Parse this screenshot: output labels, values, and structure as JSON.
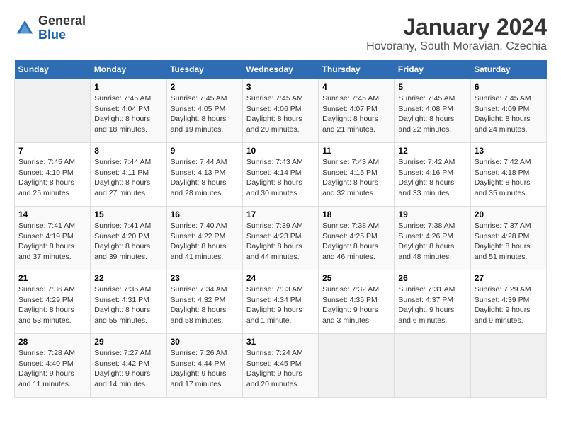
{
  "header": {
    "logo_line1": "General",
    "logo_line2": "Blue",
    "title": "January 2024",
    "subtitle": "Hovorany, South Moravian, Czechia"
  },
  "days_of_week": [
    "Sunday",
    "Monday",
    "Tuesday",
    "Wednesday",
    "Thursday",
    "Friday",
    "Saturday"
  ],
  "weeks": [
    [
      {
        "day": "",
        "empty": true
      },
      {
        "day": "1",
        "sunrise": "7:45 AM",
        "sunset": "4:04 PM",
        "daylight": "8 hours and 18 minutes."
      },
      {
        "day": "2",
        "sunrise": "7:45 AM",
        "sunset": "4:05 PM",
        "daylight": "8 hours and 19 minutes."
      },
      {
        "day": "3",
        "sunrise": "7:45 AM",
        "sunset": "4:06 PM",
        "daylight": "8 hours and 20 minutes."
      },
      {
        "day": "4",
        "sunrise": "7:45 AM",
        "sunset": "4:07 PM",
        "daylight": "8 hours and 21 minutes."
      },
      {
        "day": "5",
        "sunrise": "7:45 AM",
        "sunset": "4:08 PM",
        "daylight": "8 hours and 22 minutes."
      },
      {
        "day": "6",
        "sunrise": "7:45 AM",
        "sunset": "4:09 PM",
        "daylight": "8 hours and 24 minutes."
      }
    ],
    [
      {
        "day": "7",
        "sunrise": "7:45 AM",
        "sunset": "4:10 PM",
        "daylight": "8 hours and 25 minutes."
      },
      {
        "day": "8",
        "sunrise": "7:44 AM",
        "sunset": "4:11 PM",
        "daylight": "8 hours and 27 minutes."
      },
      {
        "day": "9",
        "sunrise": "7:44 AM",
        "sunset": "4:13 PM",
        "daylight": "8 hours and 28 minutes."
      },
      {
        "day": "10",
        "sunrise": "7:43 AM",
        "sunset": "4:14 PM",
        "daylight": "8 hours and 30 minutes."
      },
      {
        "day": "11",
        "sunrise": "7:43 AM",
        "sunset": "4:15 PM",
        "daylight": "8 hours and 32 minutes."
      },
      {
        "day": "12",
        "sunrise": "7:42 AM",
        "sunset": "4:16 PM",
        "daylight": "8 hours and 33 minutes."
      },
      {
        "day": "13",
        "sunrise": "7:42 AM",
        "sunset": "4:18 PM",
        "daylight": "8 hours and 35 minutes."
      }
    ],
    [
      {
        "day": "14",
        "sunrise": "7:41 AM",
        "sunset": "4:19 PM",
        "daylight": "8 hours and 37 minutes."
      },
      {
        "day": "15",
        "sunrise": "7:41 AM",
        "sunset": "4:20 PM",
        "daylight": "8 hours and 39 minutes."
      },
      {
        "day": "16",
        "sunrise": "7:40 AM",
        "sunset": "4:22 PM",
        "daylight": "8 hours and 41 minutes."
      },
      {
        "day": "17",
        "sunrise": "7:39 AM",
        "sunset": "4:23 PM",
        "daylight": "8 hours and 44 minutes."
      },
      {
        "day": "18",
        "sunrise": "7:38 AM",
        "sunset": "4:25 PM",
        "daylight": "8 hours and 46 minutes."
      },
      {
        "day": "19",
        "sunrise": "7:38 AM",
        "sunset": "4:26 PM",
        "daylight": "8 hours and 48 minutes."
      },
      {
        "day": "20",
        "sunrise": "7:37 AM",
        "sunset": "4:28 PM",
        "daylight": "8 hours and 51 minutes."
      }
    ],
    [
      {
        "day": "21",
        "sunrise": "7:36 AM",
        "sunset": "4:29 PM",
        "daylight": "8 hours and 53 minutes."
      },
      {
        "day": "22",
        "sunrise": "7:35 AM",
        "sunset": "4:31 PM",
        "daylight": "8 hours and 55 minutes."
      },
      {
        "day": "23",
        "sunrise": "7:34 AM",
        "sunset": "4:32 PM",
        "daylight": "8 hours and 58 minutes."
      },
      {
        "day": "24",
        "sunrise": "7:33 AM",
        "sunset": "4:34 PM",
        "daylight": "9 hours and 1 minute."
      },
      {
        "day": "25",
        "sunrise": "7:32 AM",
        "sunset": "4:35 PM",
        "daylight": "9 hours and 3 minutes."
      },
      {
        "day": "26",
        "sunrise": "7:31 AM",
        "sunset": "4:37 PM",
        "daylight": "9 hours and 6 minutes."
      },
      {
        "day": "27",
        "sunrise": "7:29 AM",
        "sunset": "4:39 PM",
        "daylight": "9 hours and 9 minutes."
      }
    ],
    [
      {
        "day": "28",
        "sunrise": "7:28 AM",
        "sunset": "4:40 PM",
        "daylight": "9 hours and 11 minutes."
      },
      {
        "day": "29",
        "sunrise": "7:27 AM",
        "sunset": "4:42 PM",
        "daylight": "9 hours and 14 minutes."
      },
      {
        "day": "30",
        "sunrise": "7:26 AM",
        "sunset": "4:44 PM",
        "daylight": "9 hours and 17 minutes."
      },
      {
        "day": "31",
        "sunrise": "7:24 AM",
        "sunset": "4:45 PM",
        "daylight": "9 hours and 20 minutes."
      },
      {
        "day": "",
        "empty": true
      },
      {
        "day": "",
        "empty": true
      },
      {
        "day": "",
        "empty": true
      }
    ]
  ]
}
